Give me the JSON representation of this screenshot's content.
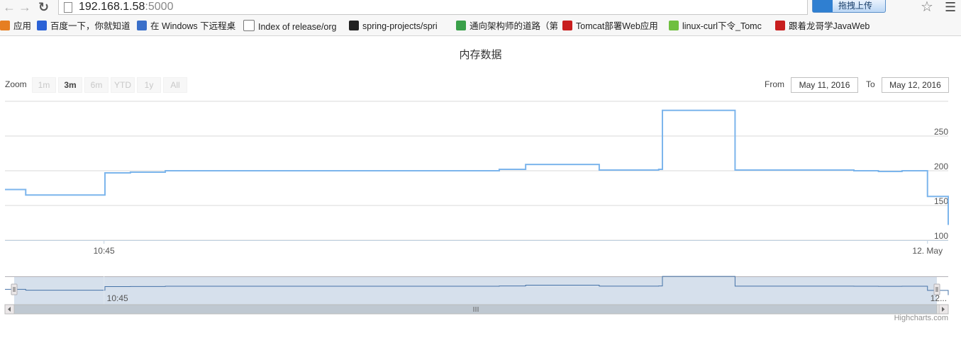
{
  "browser": {
    "url_host": "192.168.1.58",
    "url_port": ":5000",
    "extension_button": "拖拽上传"
  },
  "bookmarks": [
    {
      "label": "应用",
      "color": "#e67e22"
    },
    {
      "label": "百度一下，你就知道",
      "color": "#2b62d6"
    },
    {
      "label": "在 Windows 下远程桌",
      "color": "#3a6fc9"
    },
    {
      "label": "Index of release/org",
      "color": "#ffffff"
    },
    {
      "label": "spring-projects/spri",
      "color": "#222222"
    },
    {
      "label": "通向架构师的道路（第",
      "color": "#3aa04a"
    },
    {
      "label": "Tomcat部署Web应用",
      "color": "#c81e1e"
    },
    {
      "label": "linux-curl下令_Tomc",
      "color": "#6fbf40"
    },
    {
      "label": "跟着龙哥学JavaWeb",
      "color": "#c81e1e"
    }
  ],
  "range_selector": {
    "zoom_label": "Zoom",
    "buttons": [
      {
        "label": "1m",
        "active": false
      },
      {
        "label": "3m",
        "active": true
      },
      {
        "label": "6m",
        "active": false
      },
      {
        "label": "YTD",
        "active": false
      },
      {
        "label": "1y",
        "active": false
      },
      {
        "label": "All",
        "active": false
      }
    ],
    "from_label": "From",
    "from_value": "May 11, 2016",
    "to_label": "To",
    "to_value": "May 12, 2016"
  },
  "credits": "Highcharts.com",
  "colors": {
    "series": "#7cb5ec",
    "navigator_series": "#4572a7",
    "navigator_mask": "rgba(69,114,167,0.22)",
    "grid": "#d8d8d8"
  },
  "chart_data": {
    "type": "line",
    "step": true,
    "title": "内存数据",
    "ylim": [
      100,
      300
    ],
    "yticks": [
      100,
      150,
      200,
      250
    ],
    "xlim": [
      0,
      100
    ],
    "xticks": [
      {
        "x": 10.5,
        "label": "10:45"
      },
      {
        "x": 97.8,
        "label": "12. May"
      }
    ],
    "navigator_labels": [
      {
        "x": 10.5,
        "label": "10:45"
      },
      {
        "x": 97.8,
        "label": "12..."
      }
    ],
    "series": [
      {
        "x": [
          0,
          2.2,
          10.6,
          13.3,
          17.0,
          47.0,
          52.4,
          55.2,
          63.0,
          69.3,
          69.7,
          77.4,
          90.0,
          92.6,
          95.1,
          97.8,
          100
        ],
        "y": [
          173,
          165,
          197,
          198,
          200,
          200,
          202,
          209,
          201,
          202,
          202,
          201,
          200,
          199,
          200,
          163,
          122
        ]
      },
      {
        "x": [
          69.7,
          77.4
        ],
        "y": [
          287,
          287
        ]
      }
    ]
  }
}
